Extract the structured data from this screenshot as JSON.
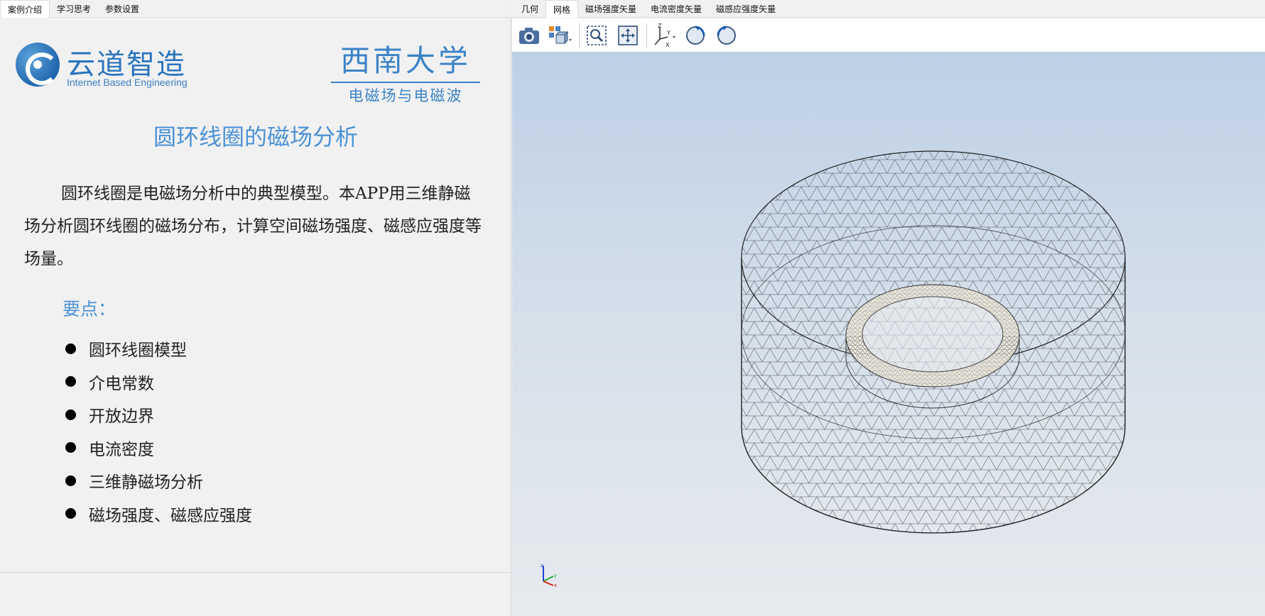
{
  "left_tabs": [
    "案例介绍",
    "学习思考",
    "参数设置"
  ],
  "brand": {
    "cn": "云道智造",
    "en": "Internet Based Engineering"
  },
  "university": {
    "name": "西南大学",
    "subtitle": "电磁场与电磁波"
  },
  "content": {
    "title": "圆环线圈的磁场分析",
    "description": "圆环线圈是电磁场分析中的典型模型。本APP用三维静磁场分析圆环线圈的磁场分布，计算空间磁场强度、磁感应强度等场量。",
    "key_points_title": "要点：",
    "key_points": [
      "圆环线圈模型",
      "介电常数",
      "开放边界",
      "电流密度",
      "三维静磁场分析",
      "磁场强度、磁感应强度"
    ]
  },
  "right_tabs": [
    "几何",
    "网格",
    "磁场强度矢量",
    "电流密度矢量",
    "磁感应强度矢量"
  ],
  "active_right_tab": 1,
  "toolbar": {
    "icons": [
      "camera-icon",
      "view-cube-icon",
      "zoom-box-icon",
      "fit-all-icon",
      "axes-orientation-icon",
      "rotate-cw-icon",
      "rotate-ccw-icon"
    ]
  },
  "viewport": {
    "model": "cylinder-mesh-with-ring-coil",
    "triad_labels": {
      "x": "x",
      "y": "y",
      "z": "z"
    }
  },
  "colors": {
    "accent": "#4c92d6",
    "mesh": "#2b2b2b",
    "bg_top": "#bdd0e5",
    "bg_bottom": "#e7eaee"
  }
}
